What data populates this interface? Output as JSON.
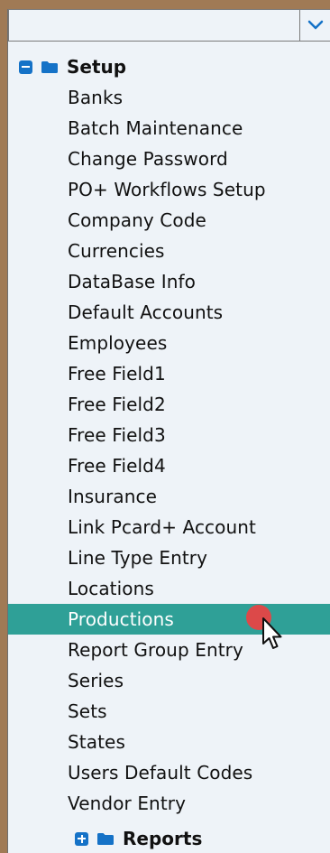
{
  "combo": {
    "value": "",
    "dropdown_icon": "chevron-down-icon"
  },
  "tree": {
    "setup": {
      "label": "Setup",
      "expander_icon": "collapse-minus-icon",
      "folder_icon": "folder-icon",
      "items": [
        {
          "label": "Banks"
        },
        {
          "label": "Batch Maintenance"
        },
        {
          "label": "Change Password"
        },
        {
          "label": "PO+ Workflows Setup"
        },
        {
          "label": "Company Code"
        },
        {
          "label": "Currencies"
        },
        {
          "label": "DataBase Info"
        },
        {
          "label": "Default Accounts"
        },
        {
          "label": "Employees"
        },
        {
          "label": "Free Field1"
        },
        {
          "label": "Free Field2"
        },
        {
          "label": "Free Field3"
        },
        {
          "label": "Free Field4"
        },
        {
          "label": "Insurance"
        },
        {
          "label": "Link Pcard+ Account"
        },
        {
          "label": "Line Type Entry"
        },
        {
          "label": "Locations"
        },
        {
          "label": "Productions",
          "selected": true
        },
        {
          "label": "Report Group Entry"
        },
        {
          "label": "Series"
        },
        {
          "label": "Sets"
        },
        {
          "label": "States"
        },
        {
          "label": "Users Default Codes"
        },
        {
          "label": "Vendor Entry"
        }
      ]
    },
    "reports": {
      "label": "Reports",
      "expander_icon": "expand-plus-icon",
      "folder_icon": "folder-icon"
    }
  },
  "colors": {
    "accent": "#1572c7",
    "selection": "#2fa097",
    "panel_bg": "#eef3f8",
    "outer_bg": "#a07a55"
  }
}
